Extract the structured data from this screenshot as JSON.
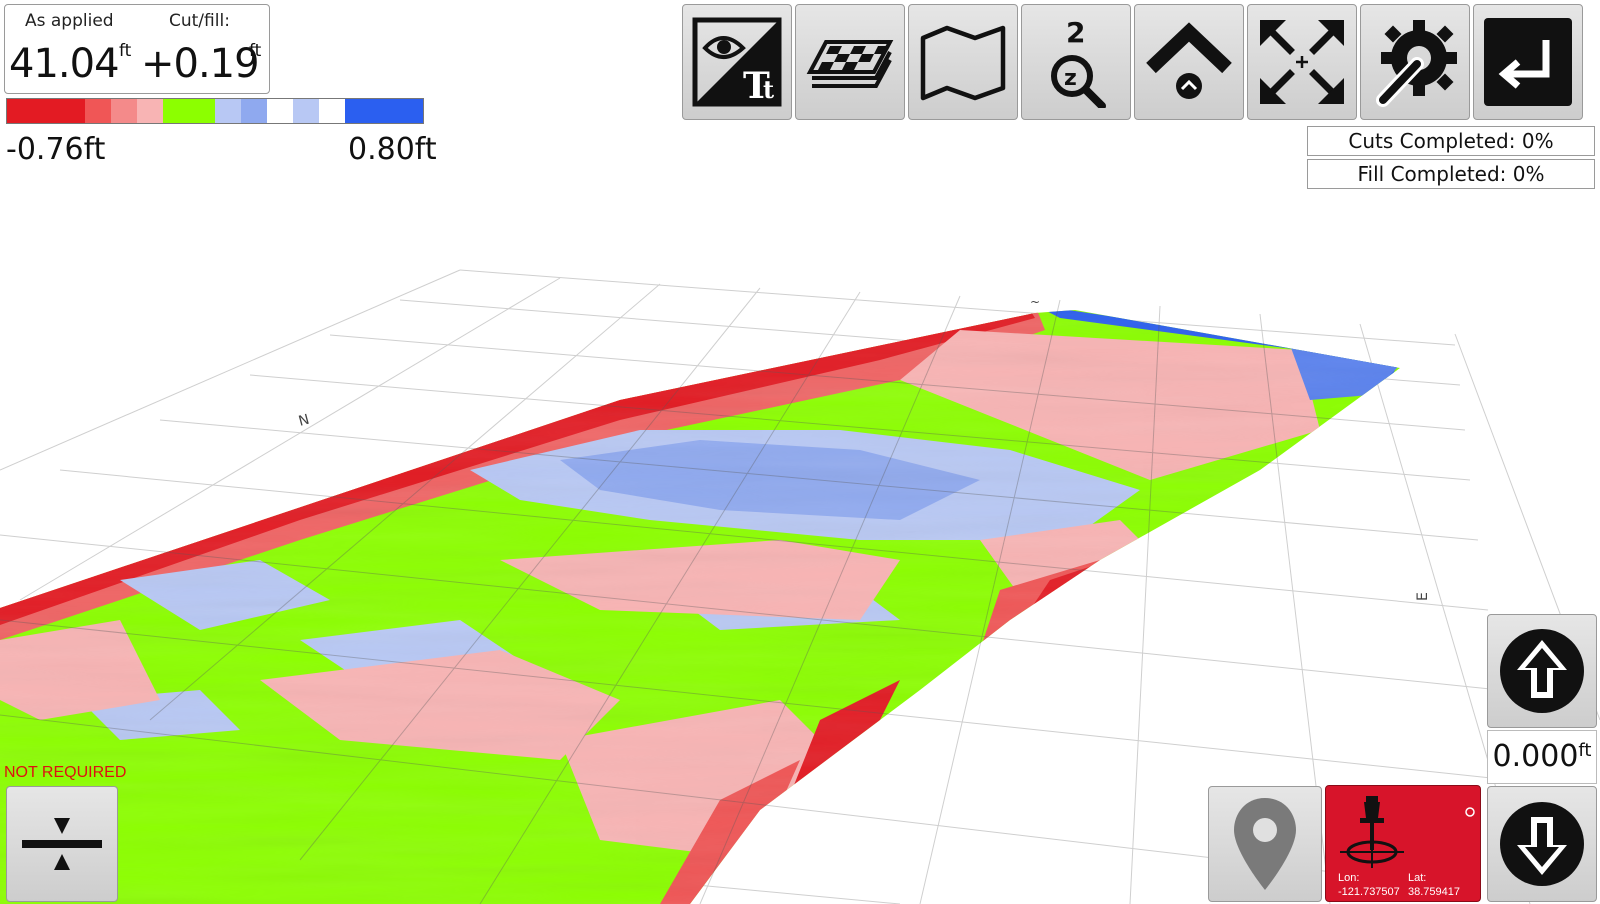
{
  "readout": {
    "as_applied_label": "As applied",
    "cut_fill_label": "Cut/fill:",
    "as_applied_value": "41.04",
    "as_applied_unit": "ft",
    "cut_fill_value": "+0.19",
    "cut_fill_unit": "ft"
  },
  "scale": {
    "min_label": "-0.76ft",
    "max_label": "0.80ft",
    "colors": [
      "#e31b23",
      "#e31b23",
      "#e31b23",
      "#f05656",
      "#f48a8a",
      "#f8b4b4",
      "#8cff00",
      "#8cff00",
      "#b8c8f4",
      "#8fa9ef",
      "#ffffff",
      "#b8c8f4",
      "#ffffff",
      "#2b5ff0",
      "#2b5ff0",
      "#2b5ff0"
    ]
  },
  "toolbar": {
    "buttons": [
      {
        "name": "view-text-toggle-button",
        "icon": "eye-text-icon"
      },
      {
        "name": "layers-button",
        "icon": "checkered-layers-icon"
      },
      {
        "name": "map-button",
        "icon": "folded-map-icon"
      },
      {
        "name": "zoom-2-button",
        "icon": "zoom-2-icon"
      },
      {
        "name": "top-view-button",
        "icon": "chevron-up-icon"
      },
      {
        "name": "fit-extents-button",
        "icon": "expand-arrows-icon"
      },
      {
        "name": "settings-button",
        "icon": "gear-wrench-icon"
      },
      {
        "name": "return-button",
        "icon": "return-arrow-icon"
      }
    ]
  },
  "status": {
    "cuts_completed": "Cuts Completed: 0%",
    "fill_completed": "Fill Completed: 0%"
  },
  "compass": {
    "north": "N",
    "east": "E"
  },
  "controls": {
    "not_required_label": "NOT REQUIRED",
    "offset_value": "0.000",
    "offset_unit": "ft"
  },
  "position": {
    "lon_label": "Lon:",
    "lon_value": "-121.737507",
    "lat_label": "Lat:",
    "lat_value": "38.759417"
  },
  "colors": {
    "cut_red": "#e31b23",
    "light_cut": "#f8b4b4",
    "on_grade_green": "#8cff00",
    "light_fill": "#b8c8f4",
    "fill_blue": "#2b5ff0",
    "pin_button_red": "#d7142a"
  }
}
